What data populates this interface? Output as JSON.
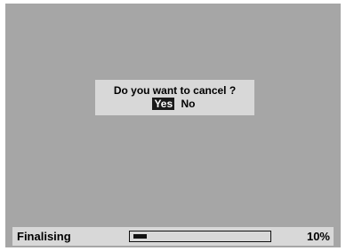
{
  "dialog": {
    "question": "Do you want to cancel ?",
    "options": [
      {
        "label": "Yes",
        "selected": true
      },
      {
        "label": "No",
        "selected": false
      }
    ]
  },
  "status": {
    "label": "Finalising",
    "progress_fraction": 0.1,
    "percent_text": "10%"
  },
  "colors": {
    "background": "#a6a6a6",
    "panel": "#d8d8d8",
    "selection": "#1a1a1a"
  }
}
